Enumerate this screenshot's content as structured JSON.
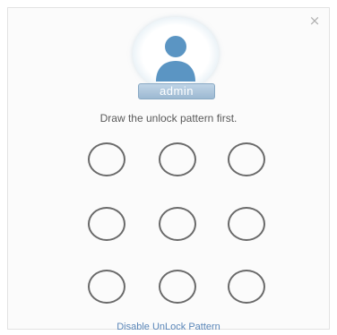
{
  "dialog": {
    "close_icon": "close-icon",
    "close_glyph": "×"
  },
  "user": {
    "avatar_icon": "user-avatar-icon",
    "name": "admin"
  },
  "prompt_text": "Draw the unlock pattern first.",
  "pattern": {
    "rows": 3,
    "cols": 3,
    "selected": []
  },
  "disable_link_label": "Disable UnLock Pattern",
  "colors": {
    "badge": "#a9c3da",
    "avatar": "#5b95c3",
    "link": "#5a86b8",
    "dot_outline": "#6a6a6a"
  }
}
